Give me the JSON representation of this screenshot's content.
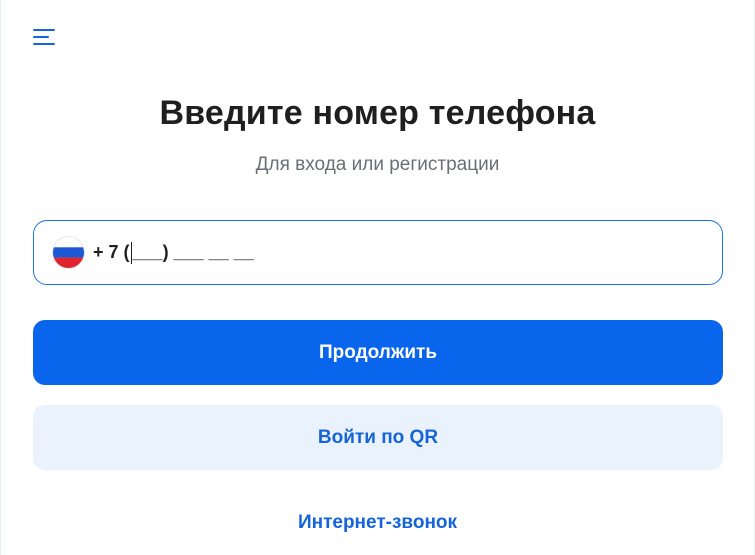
{
  "header": {
    "menu_icon": "hamburger-menu-icon"
  },
  "main": {
    "title": "Введите номер телефона",
    "subtitle": "Для входа или регистрации"
  },
  "phone": {
    "country_flag": "russia-flag-icon",
    "country_code": "+ 7",
    "open_paren": " (",
    "mask_rest": "___) ___ __ __",
    "value": ""
  },
  "buttons": {
    "continue_label": "Продолжить",
    "qr_label": "Войти по QR",
    "call_label": "Интернет-звонок"
  },
  "colors": {
    "accent": "#0a65ed",
    "accent_text": "#1565d8",
    "secondary_bg": "#eaf2fd",
    "title_text": "#1f1f1f",
    "subtitle_text": "#6b6f75",
    "field_border": "#1a73e8"
  }
}
